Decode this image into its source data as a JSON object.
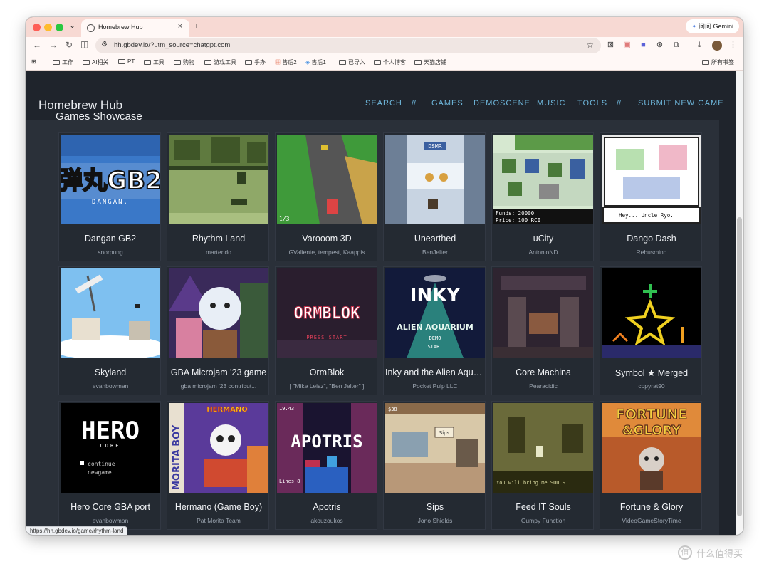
{
  "browser": {
    "tab_title": "Homebrew Hub",
    "tab_close": "×",
    "new_tab": "+",
    "tab_menu": "⌄",
    "gemini_label": "问问 Gemini",
    "url": "hh.gbdev.io/?utm_source=chatgpt.com",
    "back": "←",
    "forward": "→",
    "reload": "↻",
    "status_url": "https://hh.gbdev.io/game/rhythm-land",
    "bookmarks": [
      "工作",
      "AI相关",
      "PT",
      "工具",
      "购物",
      "游戏工具",
      "手办",
      "售后2",
      "售后1",
      "已导入",
      "个人博客",
      "天猫店铺"
    ],
    "bookmarks_right": "所有书签"
  },
  "site": {
    "title": "Homebrew Hub",
    "nav": [
      "SEARCH",
      "GAMES",
      "DEMOSCENE",
      "MUSIC",
      "TOOLS",
      "SUBMIT NEW GAME"
    ],
    "separator": "//",
    "section_title": "Games Showcase"
  },
  "games": [
    {
      "name": "Dangan GB2",
      "author": "snorpung",
      "icon": "dangan-thumb"
    },
    {
      "name": "Rhythm Land",
      "author": "martendo",
      "icon": "rhythm-land-thumb"
    },
    {
      "name": "Varooom 3D",
      "author": "GValiente, tempest, Kaappis",
      "icon": "varooom-thumb"
    },
    {
      "name": "Unearthed",
      "author": "BenJelter",
      "icon": "unearthed-thumb"
    },
    {
      "name": "uCity",
      "author": "AntonioND",
      "icon": "ucity-thumb"
    },
    {
      "name": "Dango Dash",
      "author": "Rebusmind",
      "icon": "dango-dash-thumb"
    },
    {
      "name": "Skyland",
      "author": "evanbowman",
      "icon": "skyland-thumb"
    },
    {
      "name": "GBA Microjam '23 game",
      "author": "gba microjam '23 contribut...",
      "icon": "microjam-thumb"
    },
    {
      "name": "OrmBlok",
      "author": "[ \"Mike Leisz\", \"Ben Jelter\" ]",
      "icon": "ormblok-thumb"
    },
    {
      "name": "Inky and the Alien Aqua...",
      "author": "Pocket Pulp LLC",
      "icon": "inky-thumb"
    },
    {
      "name": "Core Machina",
      "author": "Pearacidic",
      "icon": "core-machina-thumb"
    },
    {
      "name": "Symbol ★ Merged",
      "author": "copyrat90",
      "icon": "symbol-merged-thumb"
    },
    {
      "name": "Hero Core GBA port",
      "author": "evanbowman",
      "icon": "hero-core-thumb"
    },
    {
      "name": "Hermano (Game Boy)",
      "author": "Pat Morita Team",
      "icon": "hermano-thumb"
    },
    {
      "name": "Apotris",
      "author": "akouzoukos",
      "icon": "apotris-thumb"
    },
    {
      "name": "Sips",
      "author": "Jono Shields",
      "icon": "sips-thumb"
    },
    {
      "name": "Feed IT Souls",
      "author": "Gumpy Function",
      "icon": "feed-it-souls-thumb"
    },
    {
      "name": "Fortune & Glory",
      "author": "VideoGameStoryTime",
      "icon": "fortune-glory-thumb"
    }
  ],
  "thumb_text": {
    "dangan": "弹丸GB2",
    "dangan_sub": "DANGAN.",
    "varooom_lap": "1/3",
    "unearthed_hud": "DSMR",
    "ucity_funds": "Funds: 20000",
    "ucity_price": "Price: 100 RCI",
    "dango_dialog": "Hey... Uncle Ryo.",
    "ormblok": "ORMBLOK",
    "ormblok_press": "PRESS START",
    "inky_title": "INKY",
    "inky_sub": "ALIEN AQUARIUM",
    "inky_demo": "DEMO",
    "inky_start": "START",
    "hero_title": "HERO",
    "hero_sub": "CORE",
    "hero_continue": "continue",
    "hero_newgame": "newgame",
    "hermano_title": "HERMANO",
    "hermano_side": "MORITA BOY",
    "apotris": "APOTRIS",
    "apotris_time": "19.43",
    "apotris_lines": "Lines 8",
    "sips_money": "$38",
    "sips_sign": "Sips",
    "feed_text": "You will bring me SOULS...",
    "fortune_title": "FORTUNE",
    "fortune_sub": "&GLORY"
  },
  "watermark": "什么值得买",
  "watermark_icon": "值"
}
